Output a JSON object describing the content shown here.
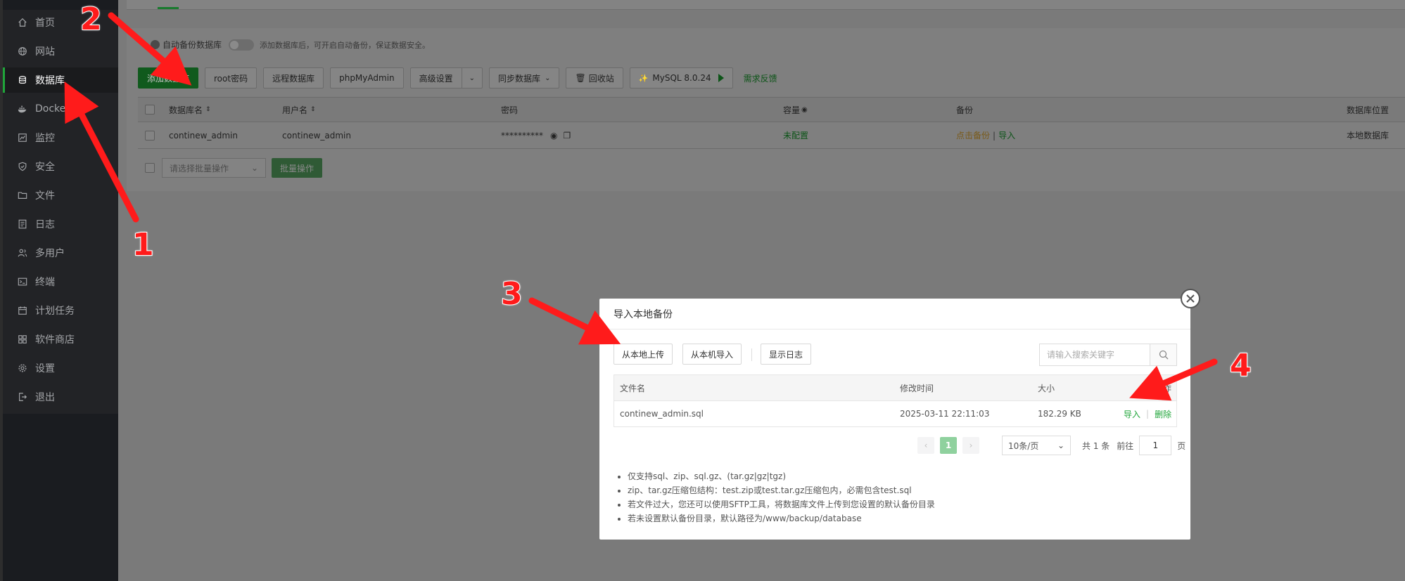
{
  "sidebar": {
    "items": [
      {
        "label": "首页",
        "icon": "home-icon"
      },
      {
        "label": "网站",
        "icon": "globe-icon"
      },
      {
        "label": "数据库",
        "icon": "database-icon",
        "active": true
      },
      {
        "label": "Docker",
        "icon": "docker-icon"
      },
      {
        "label": "监控",
        "icon": "monitor-icon"
      },
      {
        "label": "安全",
        "icon": "shield-icon"
      },
      {
        "label": "文件",
        "icon": "folder-icon"
      },
      {
        "label": "日志",
        "icon": "log-icon"
      },
      {
        "label": "多用户",
        "icon": "users-icon"
      },
      {
        "label": "终端",
        "icon": "terminal-icon"
      },
      {
        "label": "计划任务",
        "icon": "calendar-icon"
      },
      {
        "label": "软件商店",
        "icon": "apps-icon"
      },
      {
        "label": "设置",
        "icon": "gear-icon"
      },
      {
        "label": "退出",
        "icon": "logout-icon"
      }
    ]
  },
  "autobackup": {
    "label": "自动备份数据库",
    "hint": "添加数据库后，可开启自动备份，保证数据安全。"
  },
  "toolbar": {
    "add_db": "添加数据库",
    "root_pwd": "root密码",
    "remote_db": "远程数据库",
    "phpmyadmin": "phpMyAdmin",
    "advanced": "高级设置",
    "sync_db": "同步数据库",
    "recycle": "回收站",
    "mysql_version": "MySQL 8.0.24",
    "feedback": "需求反馈"
  },
  "db_table": {
    "headers": {
      "name": "数据库名",
      "user": "用户名",
      "password": "密码",
      "capacity": "容量",
      "backup": "备份",
      "location": "数据库位置"
    },
    "rows": [
      {
        "name": "continew_admin",
        "user": "continew_admin",
        "password": "**********",
        "capacity": "未配置",
        "backup_action": "点击备份",
        "import_action": "导入",
        "location": "本地数据库"
      }
    ]
  },
  "batch": {
    "select_placeholder": "请选择批量操作",
    "button": "批量操作"
  },
  "modal": {
    "title": "导入本地备份",
    "upload_local": "从本地上传",
    "import_local": "从本机导入",
    "show_log": "显示日志",
    "search_placeholder": "请输入搜索关键字",
    "headers": {
      "filename": "文件名",
      "mtime": "修改时间",
      "size": "大小",
      "ops": "操作"
    },
    "files": [
      {
        "filename": "continew_admin.sql",
        "mtime": "2025-03-11 22:11:03",
        "size": "182.29 KB",
        "import": "导入",
        "delete": "删除"
      }
    ],
    "pager": {
      "current_page": "1",
      "page_size": "10条/页",
      "total": "共 1 条",
      "goto": "前往",
      "goto_value": "1",
      "page_unit": "页"
    },
    "notes": [
      "仅支持sql、zip、sql.gz、(tar.gz|gz|tgz)",
      "zip、tar.gz压缩包结构：test.zip或test.tar.gz压缩包内，必需包含test.sql",
      "若文件过大，您还可以使用SFTP工具，将数据库文件上传到您设置的默认备份目录",
      "若未设置默认备份目录，默认路径为/www/backup/database"
    ]
  },
  "annotations": {
    "n1": "1",
    "n2": "2",
    "n3": "3",
    "n4": "4",
    "color": "#ff1b1b"
  },
  "colors": {
    "accent": "#20a53a",
    "sidebar_bg": "#222326",
    "overlay": "#7a7a7a"
  }
}
